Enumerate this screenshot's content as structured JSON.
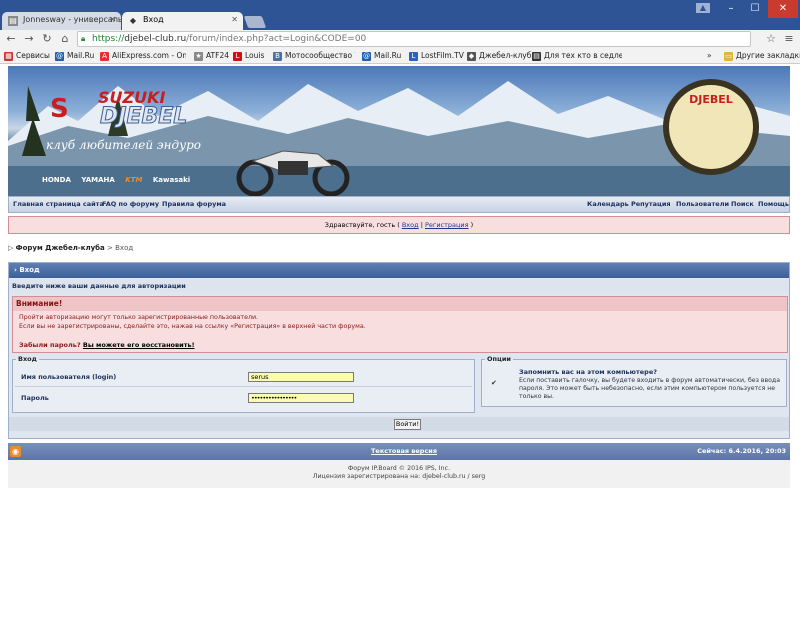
{
  "browser": {
    "tabs": [
      {
        "title": "Jonnesway - универсальн",
        "icon": "page-icon"
      },
      {
        "title": "Вход",
        "icon": "site-favicon"
      }
    ],
    "url_scheme": "https://",
    "url_host": "djebel-club.ru",
    "url_path": "/forum/index.php?act=Login&CODE=00",
    "bookmarks": [
      {
        "label": "Сервисы",
        "icon": "apps-icon",
        "color": "#c33"
      },
      {
        "label": "Mail.Ru",
        "icon": "mail-icon",
        "color": "#1f5fb0"
      },
      {
        "label": "AliExpress.com - Onli",
        "icon": "aliexpress-icon",
        "color": "#d33"
      },
      {
        "label": "ATF24",
        "icon": "star-icon",
        "color": "#888"
      },
      {
        "label": "Louis",
        "icon": "louis-icon",
        "color": "#c11"
      },
      {
        "label": "Мотосообщество Ус",
        "icon": "vk-icon",
        "color": "#4a6fa5"
      },
      {
        "label": "Mail.Ru",
        "icon": "mail-icon",
        "color": "#1f5fb0"
      },
      {
        "label": "LostFilm.TV",
        "icon": "lostfilm-icon",
        "color": "#2a64b8"
      },
      {
        "label": "Джебел-клуб",
        "icon": "site-favicon",
        "color": "#555"
      },
      {
        "label": "Для тех кто в седле -",
        "icon": "page-icon",
        "color": "#333"
      }
    ],
    "other_bookmarks": "Другие закладки"
  },
  "banner": {
    "brand": "SUZUKI",
    "model": "DJEBEL",
    "slogan": "клуб любителей эндуро",
    "makers": [
      "HONDA",
      "YAMAHA",
      "KTM",
      "Kawasaki"
    ],
    "emblem": "DJEBEL"
  },
  "nav": {
    "left": [
      "Главная страница сайта",
      "FAQ по форуму",
      "Правила форума"
    ],
    "right": [
      "Календарь",
      "Репутация",
      "Пользователи",
      "Поиск",
      "Помощь"
    ]
  },
  "welcome": {
    "text": "Здравствуйте, гость (",
    "login": "Вход",
    "sep": "|",
    "register": "Регистрация",
    "close": ")"
  },
  "breadcrumb": {
    "forum": "Форум Джебел-клуба",
    "sep": ">",
    "current": "Вход"
  },
  "login": {
    "title": "Вход",
    "subtitle": "Введите ниже ваши данные для авторизации",
    "warning_title": "Внимание!",
    "warning_line1": "Пройти авторизацию могут только зарегистрированные пользователи.",
    "warning_line2": "Если вы не зарегистрированы, сделайте это, нажав на ссылку «Регистрация» в верхней части форума.",
    "forgot_label": "Забыли пароль?",
    "forgot_link": "Вы можете его восстановить!",
    "fieldset_login": "Вход",
    "username_label": "Имя пользователя (login)",
    "username_value": "serus",
    "password_label": "Пароль",
    "password_value": "••••••••••••••••",
    "fieldset_options": "Опции",
    "remember_label": "Запомнить вас на этом компьютере?",
    "remember_desc1": "Если поставить галочку, вы будете входить в форум автоматически, без ввода",
    "remember_desc2": "пароля. Это может быть небезопасно, если этим компьютером пользуется не",
    "remember_desc3": "только вы.",
    "remember_checked": true,
    "submit": "Войти!"
  },
  "footer": {
    "text_version": "Текстовая версия",
    "time": "Сейчас: 6.4.2016, 20:03",
    "copyright": "Форум IP.Board © 2016  IPS, Inc.",
    "license": "Лицензия зарегистрирована на: djebel-club.ru / serg"
  }
}
